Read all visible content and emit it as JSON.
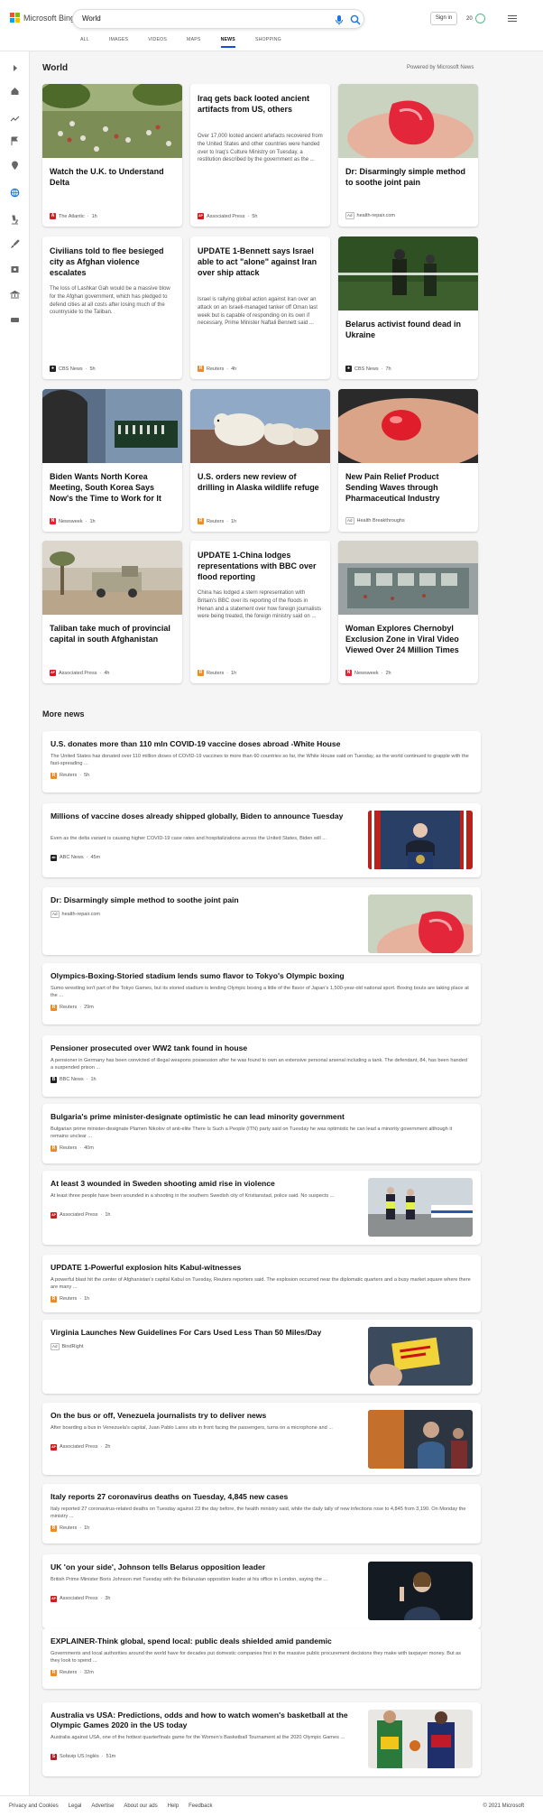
{
  "header": {
    "logo_text": "Microsoft Bing",
    "query": "World",
    "signin_label": "Sign in",
    "rewards_count": "20",
    "tabs": [
      {
        "label": "ALL"
      },
      {
        "label": "IMAGES"
      },
      {
        "label": "VIDEOS"
      },
      {
        "label": "MAPS"
      },
      {
        "label": "NEWS",
        "active": true
      },
      {
        "label": "SHOPPING"
      }
    ]
  },
  "rail_icons": [
    "expand-icon",
    "home-icon",
    "trending-icon",
    "flag-icon",
    "location-icon",
    "globe-icon",
    "microscope-icon",
    "rocket-icon",
    "money-icon",
    "bank-icon",
    "card-icon"
  ],
  "section": {
    "title": "World",
    "powered_by": "Powered by Microsoft News"
  },
  "cards": [
    {
      "title": "Watch the U.K. to Understand Delta",
      "summary": "",
      "source": "The Atlantic",
      "time": "1h",
      "ad": false,
      "logo": "A",
      "logo_color": "#cc2222"
    },
    {
      "title": "Iraq gets back looted ancient artifacts from US, others",
      "summary": "Over 17,000 looted ancient artefacts recovered from the United States and other countries were handed over to Iraq's Culture Ministry on Tuesday, a restitution described by the government as the ...",
      "source": "Associated Press",
      "time": "5h",
      "ad": false,
      "logo": "AP",
      "logo_color": "#d01c1c"
    },
    {
      "title": "Dr: Disarmingly simple method to soothe joint pain",
      "summary": "",
      "source": "health-repair.com",
      "time": "",
      "ad": true,
      "ad_label": "Ad",
      "logo": "",
      "logo_color": ""
    },
    {
      "title": "Civilians told to flee besieged city as Afghan violence escalates",
      "summary": "The loss of Lashkar Gah would be a massive blow for the Afghan government, which has pledged to defend cities at all costs after losing much of the countryside to the Taliban.",
      "source": "CBS News",
      "time": "5h",
      "ad": false,
      "logo": "●",
      "logo_color": "#222"
    },
    {
      "title": "UPDATE 1-Bennett says Israel able to act \"alone\" against Iran over ship attack",
      "summary": "Israel is rallying global action against Iran over an attack on an Israeli-managed tanker off Oman last week but is capable of responding on its own if necessary, Prime Minister Naftali Bennett said ...",
      "source": "Reuters",
      "time": "4h",
      "ad": false,
      "logo": "R",
      "logo_color": "#f08a24"
    },
    {
      "title": "Belarus activist found dead in Ukraine",
      "summary": "",
      "source": "CBS News",
      "time": "7h",
      "ad": false,
      "logo": "●",
      "logo_color": "#222"
    },
    {
      "title": "Biden Wants North Korea Meeting, South Korea Says Now's the Time to Work for It",
      "summary": "",
      "source": "Newsweek",
      "time": "1h",
      "ad": false,
      "logo": "N",
      "logo_color": "#e0262f"
    },
    {
      "title": "U.S. orders new review of drilling in Alaska wildlife refuge",
      "summary": "",
      "source": "Reuters",
      "time": "1h",
      "ad": false,
      "logo": "R",
      "logo_color": "#f08a24"
    },
    {
      "title": "New Pain Relief Product Sending Waves through Pharmaceutical Industry",
      "summary": "",
      "source": "Health Breakthroughs",
      "time": "",
      "ad": true,
      "ad_label": "Ad",
      "logo": "",
      "logo_color": ""
    },
    {
      "title": "Taliban take much of provincial capital in south Afghanistan",
      "summary": "",
      "source": "Associated Press",
      "time": "4h",
      "ad": false,
      "logo": "AP",
      "logo_color": "#d01c1c"
    },
    {
      "title": "UPDATE 1-China lodges representations with BBC over flood reporting",
      "summary": "China has lodged a stern representation with Britain's BBC over its reporting of the floods in Henan and a statement over how foreign journalists were being treated, the foreign ministry said on ...",
      "source": "Reuters",
      "time": "1h",
      "ad": false,
      "logo": "R",
      "logo_color": "#f08a24"
    },
    {
      "title": "Woman Explores Chernobyl Exclusion Zone in Viral Video Viewed Over 24 Million Times",
      "summary": "",
      "source": "Newsweek",
      "time": "2h",
      "ad": false,
      "logo": "N",
      "logo_color": "#e0262f"
    }
  ],
  "more_news": {
    "title": "More news",
    "items": [
      {
        "title": "U.S. donates more than 110 mln COVID-19 vaccine doses abroad -White House",
        "summary": "The United States has donated over 110 million doses of COVID-19 vaccines to more than 60 countries so far, the White House said on Tuesday, as the world continued to grapple with the fast-spreading ...",
        "source": "Reuters",
        "time": "5h",
        "ad": false,
        "logo": "R",
        "logo_color": "#f08a24",
        "thumb": "none"
      },
      {
        "title": "Millions of vaccine doses already shipped globally, Biden to announce Tuesday",
        "summary": "Even as the delta variant is causing higher COVID-19 case rates and hospitalizations across the United States, Biden will ...",
        "source": "ABC News",
        "time": "45m",
        "ad": false,
        "logo": "abc",
        "logo_color": "#222",
        "thumb": "podium"
      },
      {
        "title": "Dr: Disarmingly simple method to soothe joint pain",
        "summary": "",
        "source": "health-repair.com",
        "time": "",
        "ad": true,
        "ad_label": "Ad",
        "logo": "",
        "logo_color": "",
        "thumb": "gummy"
      },
      {
        "title": "Olympics-Boxing-Storied stadium lends sumo flavor to Tokyo's Olympic boxing",
        "summary": "Sumo wrestling isn't part of the Tokyo Games, but its storied stadium is lending Olympic boxing a little of the flavor of Japan's 1,500-year-old national sport. Boxing bouts are taking place at the ...",
        "source": "Reuters",
        "time": "29m",
        "ad": false,
        "logo": "R",
        "logo_color": "#f08a24",
        "thumb": "none"
      },
      {
        "title": "Pensioner prosecuted over WW2 tank found in house",
        "summary": "A pensioner in Germany has been convicted of illegal weapons possession after he was found to own an extensive personal arsenal including a tank. The defendant, 84, has been handed a suspended prison ...",
        "source": "BBC News",
        "time": "1h",
        "ad": false,
        "logo": "B",
        "logo_color": "#222",
        "thumb": "none"
      },
      {
        "title": "Bulgaria's prime minister-designate optimistic he can lead minority government",
        "summary": "Bulgarian prime minister-designate Plamen Nikolov of anti-elite There Is Such a People (ITN) party said on Tuesday he was optimistic he can lead a minority government although it remains unclear ...",
        "source": "Reuters",
        "time": "40m",
        "ad": false,
        "logo": "R",
        "logo_color": "#f08a24",
        "thumb": "none"
      },
      {
        "title": "At least 3 wounded in Sweden shooting amid rise in violence",
        "summary": "At least three people have been wounded in a shooting in the southern Swedish city of Kristianstad, police said. No suspects ...",
        "source": "Associated Press",
        "time": "1h",
        "ad": false,
        "logo": "AP",
        "logo_color": "#d01c1c",
        "thumb": "police"
      },
      {
        "title": "UPDATE 1-Powerful explosion hits Kabul-witnesses",
        "summary": "A powerful blast hit the center of Afghanistan's capital Kabul on Tuesday, Reuters reporters said. The explosion occurred near the diplomatic quarters and a busy market square where there are many ...",
        "source": "Reuters",
        "time": "1h",
        "ad": false,
        "logo": "R",
        "logo_color": "#f08a24",
        "thumb": "none"
      },
      {
        "title": "Virginia Launches New Guidelines For Cars Used Less Than 50 Miles/Day",
        "summary": "",
        "source": "BindRight",
        "time": "",
        "ad": true,
        "ad_label": "Ad",
        "logo": "",
        "logo_color": "",
        "thumb": "sign"
      },
      {
        "title": "On the bus or off, Venezuela journalists try to deliver news",
        "summary": "After boarding a bus in Venezuela's capital, Juan Pablo Lares sits in front facing the passengers, turns on a microphone and ...",
        "source": "Associated Press",
        "time": "2h",
        "ad": false,
        "logo": "AP",
        "logo_color": "#d01c1c",
        "thumb": "bus"
      },
      {
        "title": "Italy reports 27 coronavirus deaths on Tuesday, 4,845 new cases",
        "summary": "Italy reported 27 coronavirus-related deaths on Tuesday against 23 the day before, the health ministry said, while the daily tally of new infections rose to 4,845 from 3,190. On Monday the ministry ...",
        "source": "Reuters",
        "time": "1h",
        "ad": false,
        "logo": "R",
        "logo_color": "#f08a24",
        "thumb": "none"
      },
      {
        "title": "UK 'on your side', Johnson tells Belarus opposition leader",
        "summary": "British Prime Minister Boris Johnson met Tuesday with the Belarusian opposition leader at his office in London, saying the ...",
        "source": "Associated Press",
        "time": "3h",
        "ad": false,
        "logo": "AP",
        "logo_color": "#d01c1c",
        "thumb": "woman"
      },
      {
        "title": "EXPLAINER-Think global, spend local: public deals shielded amid pandemic",
        "summary": "Governments and local authorities around the world have for decades put domestic companies first in the massive public procurement decisions they make with taxpayer money. But as they look to spend ...",
        "source": "Reuters",
        "time": "32m",
        "ad": false,
        "logo": "R",
        "logo_color": "#f08a24",
        "thumb": "none"
      },
      {
        "title": "Australia vs USA: Predictions, odds and how to watch women's basketball at the Olympic Games 2020 in the US today",
        "summary": "Australia against USA, one of the hottest quarterfinals game for the Women's Basketball Tournament at the 2020 Olympic Games ...",
        "source": "Sofavip US Inglés",
        "time": "51m",
        "ad": false,
        "logo": "S",
        "logo_color": "#c3172b",
        "thumb": "basketball"
      }
    ]
  },
  "footer": {
    "links": [
      "Privacy and Cookies",
      "Legal",
      "Advertise",
      "About our ads",
      "Help",
      "Feedback"
    ],
    "copyright": "© 2021 Microsoft"
  },
  "colors": {
    "accent": "#174ae4",
    "search_icon": "#1a73e8",
    "reuters": "#f08a24",
    "ap": "#d01c1c"
  }
}
